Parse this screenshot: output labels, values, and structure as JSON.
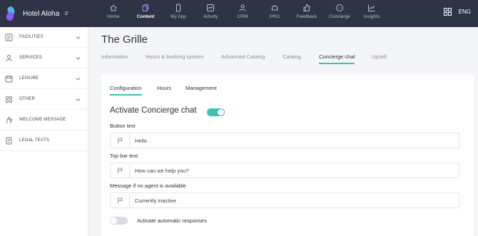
{
  "app": {
    "hotel_name": "Hotel Aloha",
    "language": "ENG"
  },
  "topnav": [
    {
      "label": "Home",
      "icon": "home-icon",
      "active": false
    },
    {
      "label": "Content",
      "icon": "content-icon",
      "active": true
    },
    {
      "label": "My App",
      "icon": "phone-icon",
      "active": false
    },
    {
      "label": "Activity",
      "icon": "activity-icon",
      "active": false
    },
    {
      "label": "CRM",
      "icon": "users-icon",
      "active": false
    },
    {
      "label": "PRO",
      "icon": "pro-icon",
      "active": false
    },
    {
      "label": "Feedback",
      "icon": "thumbs-up-icon",
      "active": false
    },
    {
      "label": "Concierge",
      "icon": "chat-icon",
      "active": false
    },
    {
      "label": "Insights",
      "icon": "chart-icon",
      "active": false
    }
  ],
  "sidebar": {
    "items": [
      {
        "label": "FACILITIES",
        "icon": "facilities-icon",
        "expandable": true
      },
      {
        "label": "SERVICES",
        "icon": "services-icon",
        "expandable": true
      },
      {
        "label": "LEISURE",
        "icon": "leisure-icon",
        "expandable": true
      },
      {
        "label": "OTHER",
        "icon": "other-icon",
        "expandable": true
      },
      {
        "label": "WELCOME MESSAGE",
        "icon": "welcome-icon",
        "expandable": false
      },
      {
        "label": "LEGAL TEXTS",
        "icon": "document-icon",
        "expandable": false
      }
    ]
  },
  "page": {
    "title": "The Grille",
    "tabs": [
      {
        "label": "Information",
        "active": false
      },
      {
        "label": "Hours & booking system",
        "active": false
      },
      {
        "label": "Advanced Catalog",
        "active": false
      },
      {
        "label": "Catalog",
        "active": false
      },
      {
        "label": "Concierge chat",
        "active": true
      },
      {
        "label": "Upsell",
        "active": false
      }
    ]
  },
  "card": {
    "subtabs": [
      {
        "label": "Configuration",
        "active": true
      },
      {
        "label": "Hours",
        "active": false
      },
      {
        "label": "Management",
        "active": false
      }
    ],
    "section_title": "Activate Concierge chat",
    "activate_toggle_on": true,
    "fields": [
      {
        "label": "Button text",
        "value": "Hello"
      },
      {
        "label": "Top bar text",
        "value": "How can we help you?"
      },
      {
        "label": "Message if no agent is available",
        "value": "Currently inactive"
      }
    ],
    "auto_responses_label": "Activate automatic responses",
    "auto_responses_on": false
  },
  "colors": {
    "topbar": "#2f3346",
    "accent": "#3cc2b1",
    "brand_blue": "#4fb6e8",
    "brand_purple": "#8b5cf6"
  }
}
